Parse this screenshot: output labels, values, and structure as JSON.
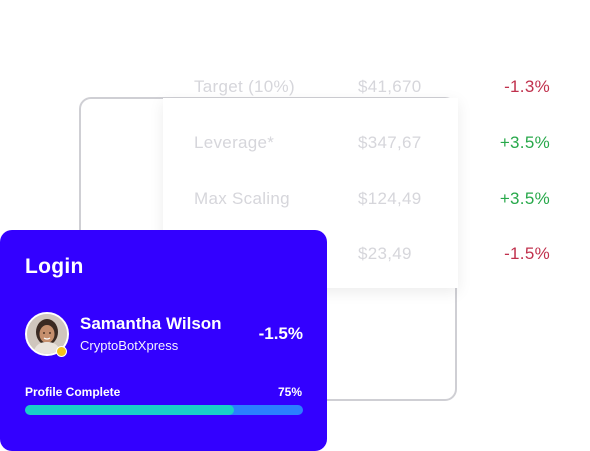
{
  "table": {
    "rows": [
      {
        "label": "Target (10%)",
        "price": "$41,670",
        "change": "-1.3%",
        "trend": "neg"
      },
      {
        "label": "Leverage*",
        "price": "$347,67",
        "change": "+3.5%",
        "trend": "pos"
      },
      {
        "label": "Max Scaling",
        "price": "$124,49",
        "change": "+3.5%",
        "trend": "pos"
      },
      {
        "label": "",
        "price": "$23,49",
        "change": "-1.5%",
        "trend": "neg"
      }
    ]
  },
  "login": {
    "title": "Login",
    "user_name": "Samantha Wilson",
    "user_sub": "CryptoBotXpress",
    "change": "-1.5%",
    "progress_label": "Profile Complete",
    "progress_value": "75%",
    "progress_fraction": 0.75
  },
  "colors": {
    "card_bg": "#3300ff",
    "progress_fill": "#19cfc8",
    "progress_track": "#2b7fff",
    "negative": "#c0314d",
    "positive": "#27a84a",
    "avatar_badge": "#f4c21b"
  },
  "icons": {
    "avatar": "user-avatar-photo",
    "badge": "status-badge-dot"
  }
}
